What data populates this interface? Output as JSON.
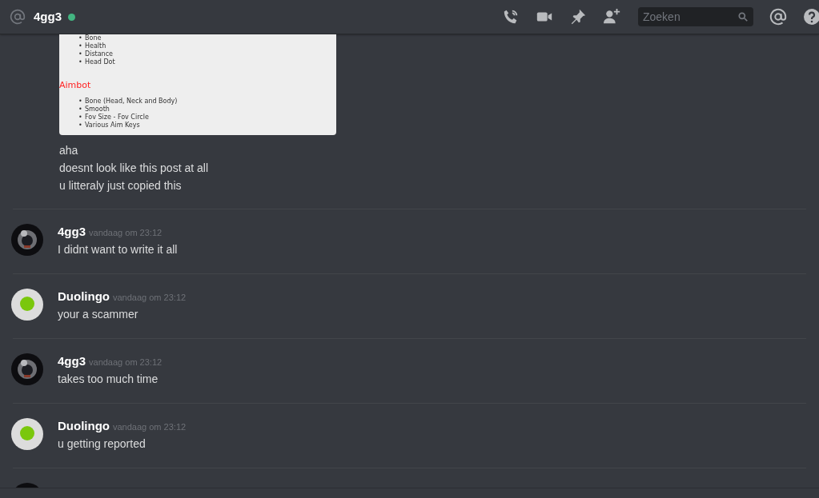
{
  "header": {
    "channel_name": "4gg3",
    "online": true,
    "search": {
      "placeholder": "Zoeken"
    }
  },
  "embed": {
    "bullet": "•",
    "list_1": [
      "Bone",
      "Health",
      "Distance",
      "Head Dot"
    ],
    "heading": "Aimbot",
    "list_2": [
      "Bone (Head, Neck and Body)",
      "Smooth",
      "Fov Size - Fov Circle",
      "Various Aim Keys"
    ]
  },
  "continued_lines": [
    "aha",
    "doesnt look like this post at all",
    "u litteraly just copied this"
  ],
  "messages": [
    {
      "author": "4gg3",
      "time": "vandaag om 23:12",
      "text": "I didnt want to write it all",
      "kind": "dark"
    },
    {
      "author": "Duolingo",
      "time": "vandaag om 23:12",
      "text": "your a scammer",
      "kind": "light"
    },
    {
      "author": "4gg3",
      "time": "vandaag om 23:12",
      "text": "takes too much time",
      "kind": "dark"
    },
    {
      "author": "Duolingo",
      "time": "vandaag om 23:12",
      "text": "u getting reported",
      "kind": "light"
    }
  ],
  "partial_message": {
    "kind": "dark"
  }
}
